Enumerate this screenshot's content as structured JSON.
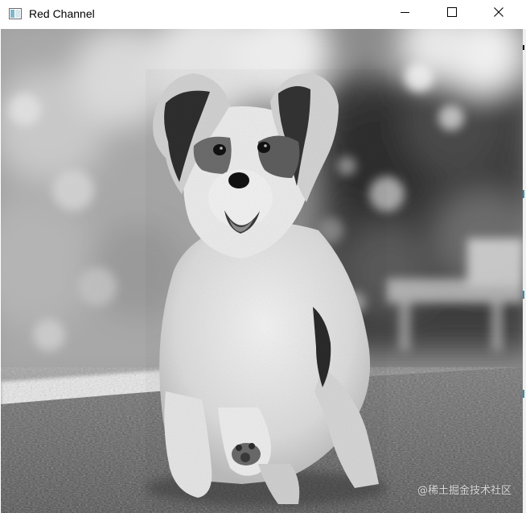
{
  "window": {
    "title": "Red Channel",
    "icon": "image-window-icon",
    "controls": {
      "minimize": "minimize-icon",
      "maximize": "maximize-icon",
      "close": "close-icon"
    }
  },
  "image": {
    "channel": "Red Channel",
    "content": "grayscale-dog-photo",
    "watermark": "@稀土掘金技术社区"
  },
  "colors": {
    "titlebar_bg": "#ffffff",
    "title_text": "#000000",
    "frame_accent": "#2f8fb4"
  }
}
